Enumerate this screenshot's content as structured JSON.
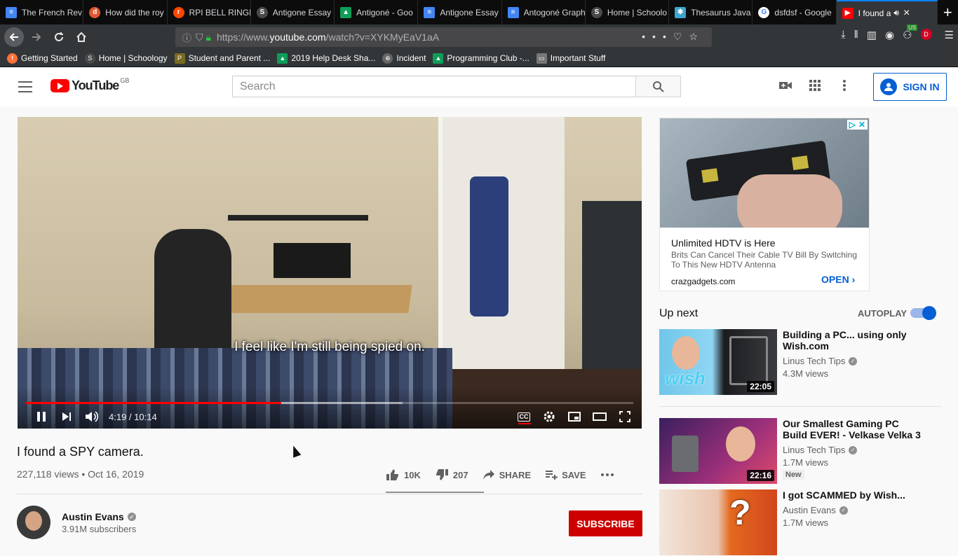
{
  "browser": {
    "tabs": [
      {
        "title": "The French Rev",
        "icon": "docs-icon",
        "color": "#4285f4"
      },
      {
        "title": "How did the roy",
        "icon": "duckduckgo-icon",
        "color": "#de5833"
      },
      {
        "title": "RPI BELL RINGE",
        "icon": "reddit-icon",
        "color": "#ff4500"
      },
      {
        "title": "Antigone Essay",
        "icon": "schoology-icon",
        "color": "#4a4a4a"
      },
      {
        "title": "Antigoné - Goo",
        "icon": "drive-icon",
        "color": "#0f9d58"
      },
      {
        "title": "Antigone Essay",
        "icon": "docs-icon",
        "color": "#4285f4"
      },
      {
        "title": "Antogoné Graph",
        "icon": "docs-icon",
        "color": "#4285f4"
      },
      {
        "title": "Home | Schoolo",
        "icon": "schoology-icon",
        "color": "#4a4a4a"
      },
      {
        "title": "Thesaurus Java",
        "icon": "puzzle-icon",
        "color": "#3aa6d0"
      },
      {
        "title": "dsfdsf - Google",
        "icon": "google-icon",
        "color": "#4285f4"
      }
    ],
    "active_tab": {
      "title": "I found a",
      "icon": "youtube-icon",
      "color": "#ff0000"
    },
    "url": {
      "prefix": "https://www.",
      "host": "youtube.com",
      "path": "/watch?v=XYKMyEaV1aA"
    },
    "bookmarks": [
      {
        "label": "Getting Started",
        "color": "#ff7139"
      },
      {
        "label": "Home | Schoology",
        "color": "#4a4a4a"
      },
      {
        "label": "Student and Parent ...",
        "color": "#7a6a1f"
      },
      {
        "label": "2019 Help Desk Sha...",
        "color": "#0f9d58"
      },
      {
        "label": "Incident",
        "color": "#666666"
      },
      {
        "label": "Programming Club -...",
        "color": "#0f9d58"
      },
      {
        "label": "Important Stuff",
        "color": "#777777"
      }
    ],
    "extension_badge": "US",
    "profile_letter": "D"
  },
  "youtube": {
    "logo": "YouTube",
    "region": "GB",
    "search_placeholder": "Search",
    "sign_in": "SIGN IN",
    "accent": "#065fd4",
    "brand_red": "#ff0000"
  },
  "player": {
    "caption": "I feel like I'm still being spied on.",
    "current_time": "4:19",
    "duration": "10:14",
    "time_display": "4:19 / 10:14",
    "played_fraction": 0.42,
    "buffered_fraction": 0.62
  },
  "video": {
    "title": "I found a SPY camera.",
    "meta": "227,118 views • Oct 16, 2019",
    "likes": "10K",
    "dislikes": "207",
    "share": "SHARE",
    "save": "SAVE"
  },
  "channel": {
    "name": "Austin Evans",
    "subscribers": "3.91M subscribers",
    "subscribe": "SUBSCRIBE"
  },
  "ad": {
    "title": "Unlimited HDTV is Here",
    "description": "Brits Can Cancel Their Cable TV Bill By Switching To This New HDTV Antenna",
    "domain": "crazgadgets.com",
    "cta": "OPEN"
  },
  "up_next": {
    "heading": "Up next",
    "autoplay": "AUTOPLAY",
    "autoplay_on": true,
    "items": [
      {
        "title": "Building a PC... using only Wish.com",
        "channel": "Linus Tech Tips",
        "views": "4.3M views",
        "duration": "22:05",
        "badge": ""
      },
      {
        "title": "Our Smallest Gaming PC Build EVER! - Velkase Velka 3",
        "channel": "Linus Tech Tips",
        "views": "1.7M views",
        "duration": "22:16",
        "badge": "New"
      },
      {
        "title": "I got SCAMMED by Wish...",
        "channel": "Austin Evans",
        "views": "1.7M views",
        "duration": "",
        "badge": ""
      }
    ]
  }
}
